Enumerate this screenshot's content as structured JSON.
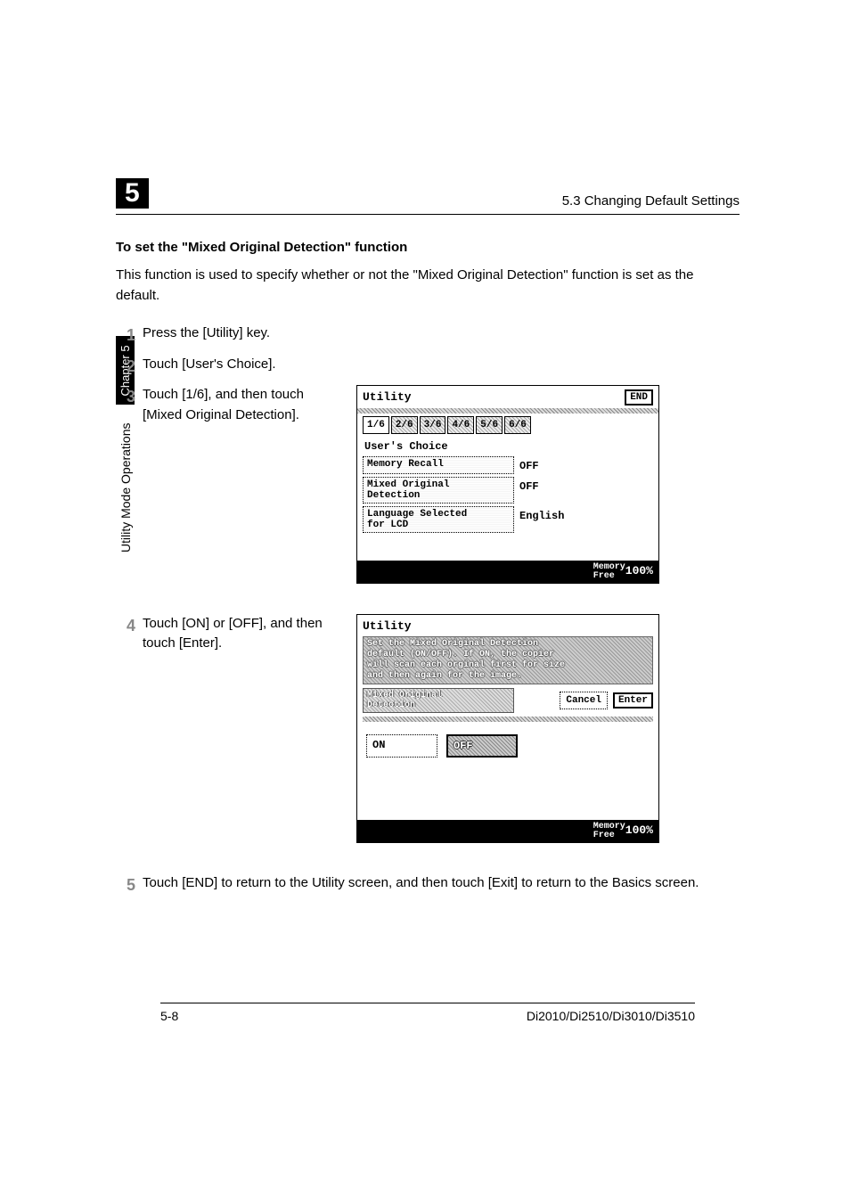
{
  "header": {
    "chapter_number": "5",
    "section_label": "5.3 Changing Default Settings"
  },
  "heading": "To set the \"Mixed Original Detection\" function",
  "intro": "This function is used to specify whether or not the \"Mixed Original Detection\" function is set as the default.",
  "steps": {
    "s1": "Press the [Utility] key.",
    "s2": "Touch [User's Choice].",
    "s3": "Touch [1/6], and then touch [Mixed Original Detection].",
    "s4": "Touch [ON] or [OFF], and then touch [Enter].",
    "s5": "Touch [END] to return to the Utility screen, and then touch [Exit] to return to the Basics screen."
  },
  "screen1": {
    "title": "Utility",
    "end": "END",
    "tabs": [
      "1/6",
      "2/6",
      "3/6",
      "4/6",
      "5/6",
      "6/6"
    ],
    "subhead": "User's Choice",
    "rows": [
      {
        "label": "Memory Recall",
        "value": "OFF"
      },
      {
        "label": "Mixed Original\nDetection",
        "value": "OFF"
      },
      {
        "label": "Language Selected\nfor LCD",
        "value": "English"
      }
    ],
    "memory": {
      "label": "Memory\nFree",
      "value": "100%"
    }
  },
  "screen2": {
    "title": "Utility",
    "message": "Set the Mixed Original Detection\ndefault (ON/OFF). If ON, the copier\nwill scan each orginal first for size\nand then again for the image.",
    "item_label": "Mixed Original\nDetection",
    "cancel": "Cancel",
    "enter": "Enter",
    "on": "ON",
    "off": "OFF",
    "memory": {
      "label": "Memory\nFree",
      "value": "100%"
    }
  },
  "side": {
    "text": "Utility Mode Operations",
    "chapter": "Chapter 5"
  },
  "footer": {
    "page": "5-8",
    "model": "Di2010/Di2510/Di3010/Di3510"
  }
}
